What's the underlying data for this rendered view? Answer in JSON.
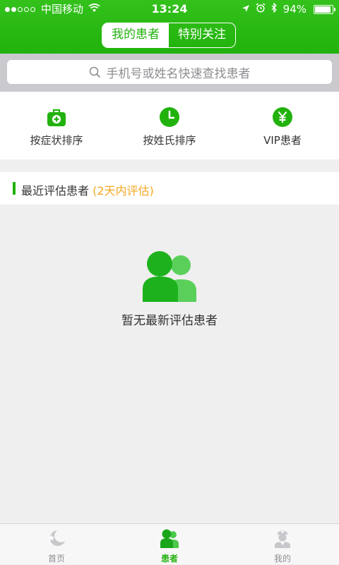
{
  "status_bar": {
    "signal_dots_filled": 2,
    "signal_dots_total": 5,
    "carrier": "中国移动",
    "time": "13:24",
    "battery_percent": "94%",
    "battery_level": 0.94
  },
  "segmented": {
    "left_label": "我的患者",
    "right_label": "特别关注",
    "selected": "我的患者"
  },
  "search": {
    "placeholder": "手机号或姓名快速查找患者"
  },
  "categories": [
    {
      "label": "按症状排序",
      "icon": "medical-kit-icon"
    },
    {
      "label": "按姓氏排序",
      "icon": "clock-icon"
    },
    {
      "label": "VIP患者",
      "icon": "yen-icon"
    }
  ],
  "recent": {
    "title": "最近评估患者",
    "subtitle": "(2天内评估)"
  },
  "empty": {
    "text": "暂无最新评估患者",
    "icon": "patients-group-icon"
  },
  "tabbar": [
    {
      "label": "首页",
      "icon": "moon-star-icon",
      "active": false
    },
    {
      "label": "患者",
      "icon": "patients-icon",
      "active": true
    },
    {
      "label": "我的",
      "icon": "nurse-icon",
      "active": false
    }
  ],
  "colors": {
    "accent": "#22b20e",
    "highlight": "#f5a623"
  }
}
